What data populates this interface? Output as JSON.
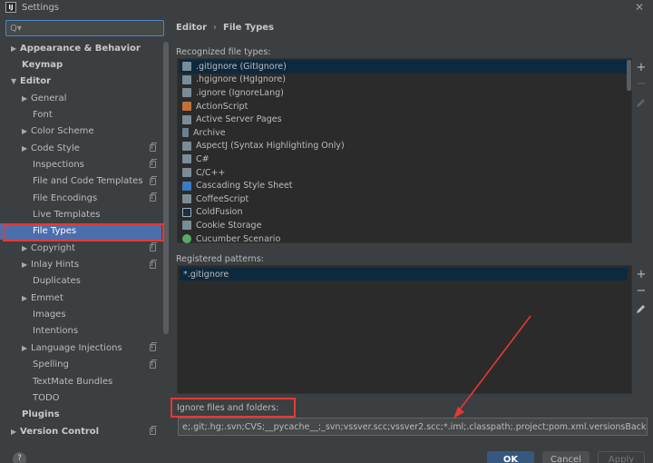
{
  "window": {
    "title": "Settings",
    "app_icon_text": "IJ"
  },
  "search": {
    "placeholder": "Q▾"
  },
  "sidebar": {
    "items": [
      {
        "label": "Appearance & Behavior",
        "arrow": "▶",
        "bold": true,
        "level": 0,
        "copy": false
      },
      {
        "label": "Keymap",
        "arrow": "",
        "bold": true,
        "level": 0,
        "copy": false
      },
      {
        "label": "Editor",
        "arrow": "▼",
        "bold": true,
        "level": 0,
        "copy": false
      },
      {
        "label": "General",
        "arrow": "▶",
        "bold": false,
        "level": 1,
        "copy": false
      },
      {
        "label": "Font",
        "arrow": "",
        "bold": false,
        "level": 1,
        "copy": false
      },
      {
        "label": "Color Scheme",
        "arrow": "▶",
        "bold": false,
        "level": 1,
        "copy": false
      },
      {
        "label": "Code Style",
        "arrow": "▶",
        "bold": false,
        "level": 1,
        "copy": true
      },
      {
        "label": "Inspections",
        "arrow": "",
        "bold": false,
        "level": 1,
        "copy": true
      },
      {
        "label": "File and Code Templates",
        "arrow": "",
        "bold": false,
        "level": 1,
        "copy": true
      },
      {
        "label": "File Encodings",
        "arrow": "",
        "bold": false,
        "level": 1,
        "copy": true
      },
      {
        "label": "Live Templates",
        "arrow": "",
        "bold": false,
        "level": 1,
        "copy": false
      },
      {
        "label": "File Types",
        "arrow": "",
        "bold": false,
        "level": 1,
        "copy": false,
        "selected": true
      },
      {
        "label": "Copyright",
        "arrow": "▶",
        "bold": false,
        "level": 1,
        "copy": true
      },
      {
        "label": "Inlay Hints",
        "arrow": "▶",
        "bold": false,
        "level": 1,
        "copy": true
      },
      {
        "label": "Duplicates",
        "arrow": "",
        "bold": false,
        "level": 1,
        "copy": false
      },
      {
        "label": "Emmet",
        "arrow": "▶",
        "bold": false,
        "level": 1,
        "copy": false
      },
      {
        "label": "Images",
        "arrow": "",
        "bold": false,
        "level": 1,
        "copy": false
      },
      {
        "label": "Intentions",
        "arrow": "",
        "bold": false,
        "level": 1,
        "copy": false
      },
      {
        "label": "Language Injections",
        "arrow": "▶",
        "bold": false,
        "level": 1,
        "copy": true
      },
      {
        "label": "Spelling",
        "arrow": "",
        "bold": false,
        "level": 1,
        "copy": true
      },
      {
        "label": "TextMate Bundles",
        "arrow": "",
        "bold": false,
        "level": 1,
        "copy": false
      },
      {
        "label": "TODO",
        "arrow": "",
        "bold": false,
        "level": 1,
        "copy": false
      },
      {
        "label": "Plugins",
        "arrow": "",
        "bold": true,
        "level": 0,
        "copy": false
      },
      {
        "label": "Version Control",
        "arrow": "▶",
        "bold": true,
        "level": 0,
        "copy": true
      }
    ]
  },
  "breadcrumb": {
    "parent": "Editor",
    "separator": "›",
    "current": "File Types"
  },
  "recognized": {
    "label": "Recognized file types:",
    "items": [
      {
        "label": ".gitignore (GitIgnore)",
        "icon": "file-icon",
        "selected": true
      },
      {
        "label": ".hgignore (HgIgnore)",
        "icon": "file-icon"
      },
      {
        "label": ".ignore (IgnoreLang)",
        "icon": "file-icon"
      },
      {
        "label": "ActionScript",
        "icon": "actionscript-icon"
      },
      {
        "label": "Active Server Pages",
        "icon": "file-icon"
      },
      {
        "label": "Archive",
        "icon": "archive-icon"
      },
      {
        "label": "AspectJ (Syntax Highlighting Only)",
        "icon": "file-icon"
      },
      {
        "label": "C#",
        "icon": "file-icon"
      },
      {
        "label": "C/C++",
        "icon": "file-icon"
      },
      {
        "label": "Cascading Style Sheet",
        "icon": "css-icon"
      },
      {
        "label": "CoffeeScript",
        "icon": "file-icon"
      },
      {
        "label": "ColdFusion",
        "icon": "coldfusion-icon"
      },
      {
        "label": "Cookie Storage",
        "icon": "file-icon"
      },
      {
        "label": "Cucumber Scenario",
        "icon": "cucumber-icon"
      }
    ]
  },
  "patterns": {
    "label": "Registered patterns:",
    "items": [
      "*.gitignore"
    ]
  },
  "ignore": {
    "label": "Ignore files and folders:",
    "value": "e;.git;.hg;.svn;CVS;__pycache__;_svn;vssver.scc;vssver2.scc;*.iml;.classpath;.project;pom.xml.versionsBackup;.idea;.settings;"
  },
  "buttons": {
    "help": "?",
    "ok": "OK",
    "cancel": "Cancel",
    "apply": "Apply"
  },
  "icons": {
    "add": "+",
    "remove": "−",
    "close": "✕"
  },
  "colors": {
    "selection": "#4b6eaf",
    "annotation": "#e53935",
    "primary_button": "#365880"
  }
}
